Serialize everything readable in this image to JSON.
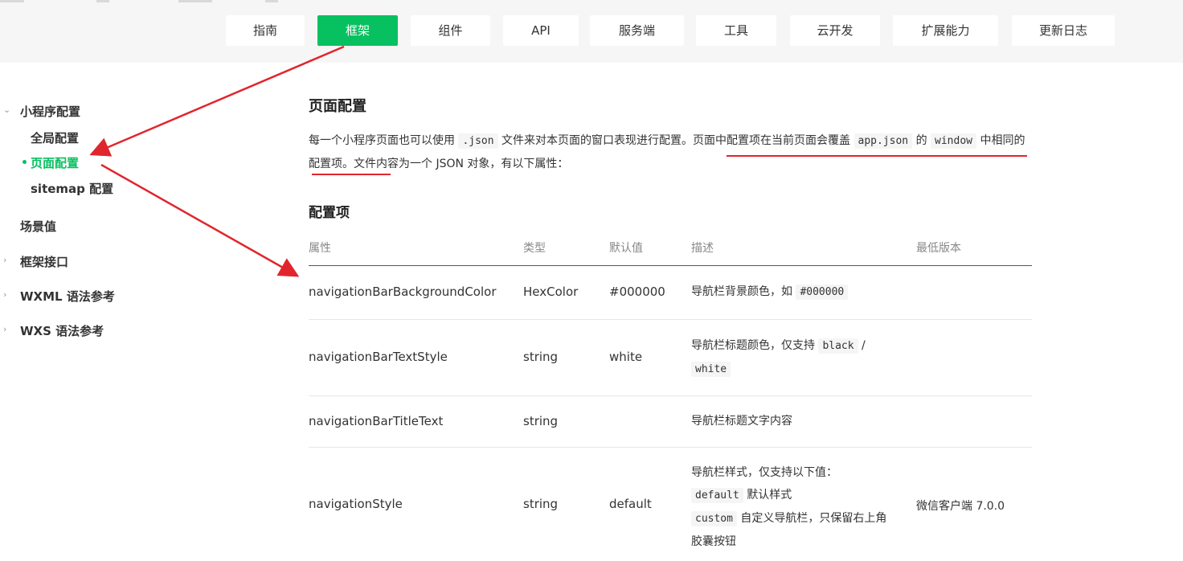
{
  "nav": {
    "tabs": [
      {
        "label": "指南",
        "active": false
      },
      {
        "label": "框架",
        "active": true
      },
      {
        "label": "组件",
        "active": false
      },
      {
        "label": "API",
        "active": false
      },
      {
        "label": "服务端",
        "active": false
      },
      {
        "label": "工具",
        "active": false
      },
      {
        "label": "云开发",
        "active": false
      },
      {
        "label": "扩展能力",
        "active": false
      },
      {
        "label": "更新日志",
        "active": false
      }
    ]
  },
  "sidebar": {
    "groups": [
      {
        "label": "小程序配置",
        "caret": "chevron-down-icon"
      },
      {
        "label": "场景值",
        "caret": ""
      },
      {
        "label": "框架接口",
        "caret": "chevron-right-icon"
      },
      {
        "label": "WXML 语法参考",
        "caret": "chevron-right-icon"
      },
      {
        "label": "WXS 语法参考",
        "caret": "chevron-right-icon"
      }
    ],
    "subitems": [
      {
        "label": "全局配置",
        "active": false
      },
      {
        "label": "页面配置",
        "active": true
      },
      {
        "label": "sitemap 配置",
        "active": false
      }
    ]
  },
  "content": {
    "title": "页面配置",
    "para": {
      "p1": "每一个小程序页面也可以使用 ",
      "code1": ".json",
      "p2": " 文件来对本页面的窗口表现进行配置。页面中配置项在当前页面会覆盖 ",
      "code2": "app.json",
      "p3": " 的 ",
      "code3": "window",
      "p4": " 中相同的配置项。文件内容为一个 JSON 对象，有以下属性："
    },
    "section_title": "配置项",
    "table": {
      "headers": [
        "属性",
        "类型",
        "默认值",
        "描述",
        "最低版本"
      ],
      "rows": [
        {
          "prop": "navigationBarBackgroundColor",
          "type": "HexColor",
          "default": "#000000",
          "desc_text": "导航栏背景颜色，如 ",
          "desc_code": "#000000",
          "version": ""
        },
        {
          "prop": "navigationBarTextStyle",
          "type": "string",
          "default": "white",
          "desc_text": "导航栏标题颜色，仅支持 ",
          "desc_code1": "black",
          "desc_sep": " / ",
          "desc_code2": "white",
          "version": ""
        },
        {
          "prop": "navigationBarTitleText",
          "type": "string",
          "default": "",
          "desc_text": "导航栏标题文字内容",
          "version": ""
        },
        {
          "prop": "navigationStyle",
          "type": "string",
          "default": "default",
          "desc_line1": "导航栏样式，仅支持以下值：",
          "desc_code1": "default",
          "desc_line2": " 默认样式",
          "desc_code2": "custom",
          "desc_line3": " 自定义导航栏，只保留右上角胶囊按钮",
          "version": "微信客户端 7.0.0"
        }
      ]
    }
  },
  "colors": {
    "accent": "#07c160",
    "annotation": "#e0262d"
  }
}
